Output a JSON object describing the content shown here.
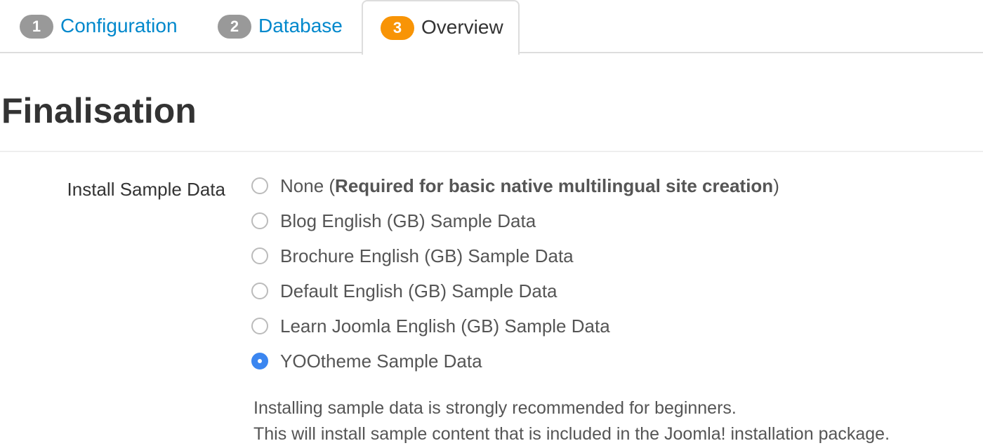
{
  "tabs": [
    {
      "number": "1",
      "label": "Configuration",
      "state": "complete"
    },
    {
      "number": "2",
      "label": "Database",
      "state": "complete"
    },
    {
      "number": "3",
      "label": "Overview",
      "state": "active"
    }
  ],
  "colors": {
    "link": "#0088cc",
    "badge_inactive": "#999999",
    "badge_active": "#f89406",
    "radio_checked": "#3b86f0"
  },
  "page_title": "Finalisation",
  "sample_data": {
    "label": "Install Sample Data",
    "options": [
      {
        "prefix": "None (",
        "bold": "Required for basic native multilingual site creation",
        "suffix": ")",
        "checked": false
      },
      {
        "prefix": "Blog English (GB) Sample Data",
        "bold": "",
        "suffix": "",
        "checked": false
      },
      {
        "prefix": "Brochure English (GB) Sample Data",
        "bold": "",
        "suffix": "",
        "checked": false
      },
      {
        "prefix": "Default English (GB) Sample Data",
        "bold": "",
        "suffix": "",
        "checked": false
      },
      {
        "prefix": "Learn Joomla English (GB) Sample Data",
        "bold": "",
        "suffix": "",
        "checked": false
      },
      {
        "prefix": "YOOtheme Sample Data",
        "bold": "",
        "suffix": "",
        "checked": true
      }
    ],
    "help_line_1": "Installing sample data is strongly recommended for beginners.",
    "help_line_2": "This will install sample content that is included in the Joomla! installation package."
  }
}
